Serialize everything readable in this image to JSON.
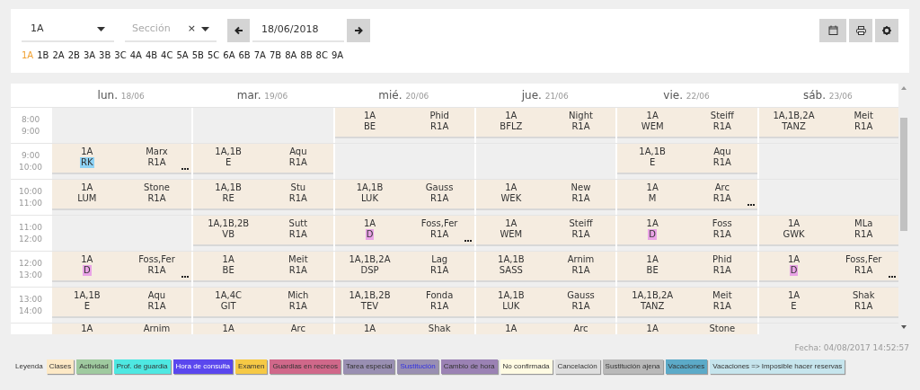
{
  "filters": {
    "group_select": {
      "value": "1A"
    },
    "section_select": {
      "placeholder": "Sección",
      "clear": "×"
    },
    "date_field": {
      "value": "18/06/2018"
    }
  },
  "class_tabs": [
    {
      "label": "1A",
      "selected": true
    },
    {
      "label": "1B",
      "selected": false
    },
    {
      "label": "2A",
      "selected": false
    },
    {
      "label": "2B",
      "selected": false
    },
    {
      "label": "3A",
      "selected": false
    },
    {
      "label": "3B",
      "selected": false
    },
    {
      "label": "3C",
      "selected": false
    },
    {
      "label": "4A",
      "selected": false
    },
    {
      "label": "4B",
      "selected": false
    },
    {
      "label": "4C",
      "selected": false
    },
    {
      "label": "5A",
      "selected": false
    },
    {
      "label": "5B",
      "selected": false
    },
    {
      "label": "5C",
      "selected": false
    },
    {
      "label": "6A",
      "selected": false
    },
    {
      "label": "6B",
      "selected": false
    },
    {
      "label": "7A",
      "selected": false
    },
    {
      "label": "7B",
      "selected": false
    },
    {
      "label": "8A",
      "selected": false
    },
    {
      "label": "8B",
      "selected": false
    },
    {
      "label": "8C",
      "selected": false
    },
    {
      "label": "9A",
      "selected": false
    }
  ],
  "days": [
    {
      "name": "lun.",
      "date": "18/06"
    },
    {
      "name": "mar.",
      "date": "19/06"
    },
    {
      "name": "mié.",
      "date": "20/06"
    },
    {
      "name": "jue.",
      "date": "21/06"
    },
    {
      "name": "vie.",
      "date": "22/06"
    },
    {
      "name": "sáb.",
      "date": "23/06"
    }
  ],
  "rows": [
    {
      "start": "8:00",
      "end": "9:00",
      "cells": [
        null,
        null,
        {
          "groups": "1A",
          "subject": "BE",
          "teacher": "Phid",
          "room": "R1A",
          "more": false
        },
        {
          "groups": "1A",
          "subject": "BFLZ",
          "teacher": "Night",
          "room": "R1A",
          "more": false
        },
        {
          "groups": "1A",
          "subject": "WEM",
          "teacher": "Steiff",
          "room": "R1A",
          "more": false
        },
        {
          "groups": "1A,1B,2A",
          "subject": "TANZ",
          "teacher": "Meit",
          "room": "R1A",
          "more": false
        }
      ]
    },
    {
      "start": "9:00",
      "end": "10:00",
      "cells": [
        {
          "groups": "1A",
          "subject": "RK",
          "teacher": "Marx",
          "room": "R1A",
          "more": true,
          "color": "#8fd3f5"
        },
        {
          "groups": "1A,1B",
          "subject": "E",
          "teacher": "Aqu",
          "room": "R1A",
          "more": false
        },
        null,
        null,
        {
          "groups": "1A,1B",
          "subject": "E",
          "teacher": "Aqu",
          "room": "R1A",
          "more": false
        },
        null
      ]
    },
    {
      "start": "10:00",
      "end": "11:00",
      "cells": [
        {
          "groups": "1A",
          "subject": "LUM",
          "teacher": "Stone",
          "room": "R1A",
          "more": false
        },
        {
          "groups": "1A,1B",
          "subject": "RE",
          "teacher": "Stu",
          "room": "R1A",
          "more": false
        },
        {
          "groups": "1A,1B",
          "subject": "LUK",
          "teacher": "Gauss",
          "room": "R1A",
          "more": false
        },
        {
          "groups": "1A",
          "subject": "WEK",
          "teacher": "New",
          "room": "R1A",
          "more": false
        },
        {
          "groups": "1A",
          "subject": "M",
          "teacher": "Arc",
          "room": "R1A",
          "more": true
        },
        null
      ]
    },
    {
      "start": "11:00",
      "end": "12:00",
      "cells": [
        null,
        {
          "groups": "1A,1B,2B",
          "subject": "VB",
          "teacher": "Sutt",
          "room": "R1A",
          "more": false
        },
        {
          "groups": "1A",
          "subject": "D",
          "teacher": "Foss,Fer",
          "room": "R1A",
          "more": true,
          "color": "#e9a3e6"
        },
        {
          "groups": "1A",
          "subject": "WEM",
          "teacher": "Steiff",
          "room": "R1A",
          "more": false
        },
        {
          "groups": "1A",
          "subject": "D",
          "teacher": "Foss",
          "room": "R1A",
          "more": false,
          "color": "#e9a3e6"
        },
        {
          "groups": "1A",
          "subject": "GWK",
          "teacher": "MLa",
          "room": "R1A",
          "more": false
        }
      ]
    },
    {
      "start": "12:00",
      "end": "13:00",
      "cells": [
        {
          "groups": "1A",
          "subject": "D",
          "teacher": "Foss,Fer",
          "room": "R1A",
          "more": true,
          "color": "#e9a3e6"
        },
        {
          "groups": "1A",
          "subject": "BE",
          "teacher": "Meit",
          "room": "R1A",
          "more": false
        },
        {
          "groups": "1A,1B,2A",
          "subject": "DSP",
          "teacher": "Lag",
          "room": "R1A",
          "more": false
        },
        {
          "groups": "1A,1B",
          "subject": "SASS",
          "teacher": "Arnim",
          "room": "R1A",
          "more": false
        },
        {
          "groups": "1A",
          "subject": "BE",
          "teacher": "Phid",
          "room": "R1A",
          "more": false
        },
        {
          "groups": "1A",
          "subject": "D",
          "teacher": "Foss,Fer",
          "room": "R1A",
          "more": true,
          "color": "#e9a3e6"
        }
      ]
    },
    {
      "start": "13:00",
      "end": "14:00",
      "cells": [
        {
          "groups": "1A,1B",
          "subject": "E",
          "teacher": "Aqu",
          "room": "R1A",
          "more": false
        },
        {
          "groups": "1A,4C",
          "subject": "GIT",
          "teacher": "Mich",
          "room": "R1A",
          "more": false
        },
        {
          "groups": "1A,1B,2B",
          "subject": "TEV",
          "teacher": "Fonda",
          "room": "R1A",
          "more": false
        },
        {
          "groups": "1A,1B",
          "subject": "LUK",
          "teacher": "Gauss",
          "room": "R1A",
          "more": false
        },
        {
          "groups": "1A,1B,2A",
          "subject": "TANZ",
          "teacher": "Meit",
          "room": "R1A",
          "more": false
        },
        {
          "groups": "1A",
          "subject": "E",
          "teacher": "Shak",
          "room": "R1A",
          "more": false
        }
      ]
    },
    {
      "cells": [
        {
          "groups": "1A",
          "teacher": "Arnim"
        },
        {
          "groups": "1A",
          "teacher": "Arc"
        },
        {
          "groups": "1A",
          "teacher": "Shak"
        },
        {
          "groups": "1A",
          "teacher": "Arc"
        },
        {
          "groups": "1A",
          "teacher": "Stone"
        },
        null
      ]
    }
  ],
  "timestamp": "Fecha: 04/08/2017 14:52:57",
  "legend": {
    "title": "Leyenda",
    "items": [
      {
        "label": "Clases",
        "color": "#fde9c6",
        "kind": "normal"
      },
      {
        "label": "Actividad",
        "color": "#9fca9f",
        "kind": "normal"
      },
      {
        "label": "Prof. de guardia",
        "color": "#4ee8e2",
        "kind": "normal"
      },
      {
        "label": "Hora de consulta",
        "color": "#5a47ee",
        "kind": "inverse"
      },
      {
        "label": "Examen",
        "color": "#f6c945",
        "kind": "normal"
      },
      {
        "label": "Guardias en recreos",
        "color": "#d0688a",
        "kind": "normal"
      },
      {
        "label": "Tarea especial",
        "color": "#998fb2",
        "kind": "normal"
      },
      {
        "label": "Sustitución",
        "color": "#998fb2",
        "kind": "accent"
      },
      {
        "label": "Cambio de hora",
        "color": "#9b82b4",
        "kind": "normal"
      },
      {
        "label": "No confirmada",
        "color": "#fffbe3",
        "kind": "normal"
      },
      {
        "label": "Cancelación",
        "color": "#dedede",
        "kind": "normal"
      },
      {
        "label": "Sustitución ajena",
        "color": "#b9b9b9",
        "kind": "normal"
      },
      {
        "label": "Vacaciones",
        "color": "#5caac8",
        "kind": "normal"
      },
      {
        "label": "Vacaciones => Imposible hacer reservas",
        "color": "#c6e5ed",
        "kind": "normal"
      }
    ]
  }
}
